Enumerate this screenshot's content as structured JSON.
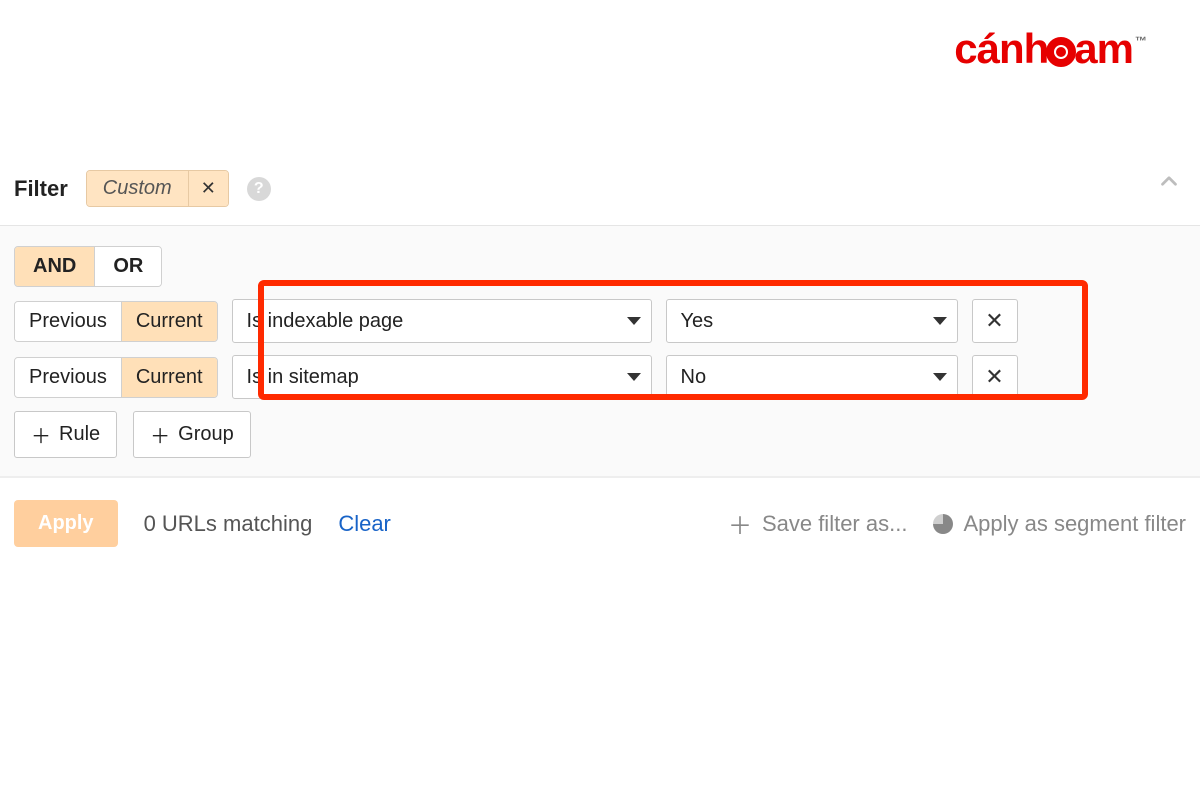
{
  "brand": {
    "wordA": "cánh",
    "wordB": "am",
    "tm": "™"
  },
  "header": {
    "filter_label": "Filter",
    "chip_label": "Custom"
  },
  "logic": {
    "and": "AND",
    "or": "OR",
    "active": "AND"
  },
  "version_toggle": {
    "previous": "Previous",
    "current": "Current",
    "active": "Current"
  },
  "rules": [
    {
      "field": "Is indexable page",
      "value": "Yes"
    },
    {
      "field": "Is in sitemap",
      "value": "No"
    }
  ],
  "buttons": {
    "add_rule": "Rule",
    "add_group": "Group",
    "apply": "Apply",
    "clear": "Clear",
    "save_filter_as": "Save filter as...",
    "apply_as_segment": "Apply as segment filter"
  },
  "footer": {
    "matching": "0 URLs matching"
  },
  "colors": {
    "accent": "#ffe0b8",
    "brand": "#e60000",
    "highlight": "#ff2a00",
    "link": "#1863c7"
  }
}
